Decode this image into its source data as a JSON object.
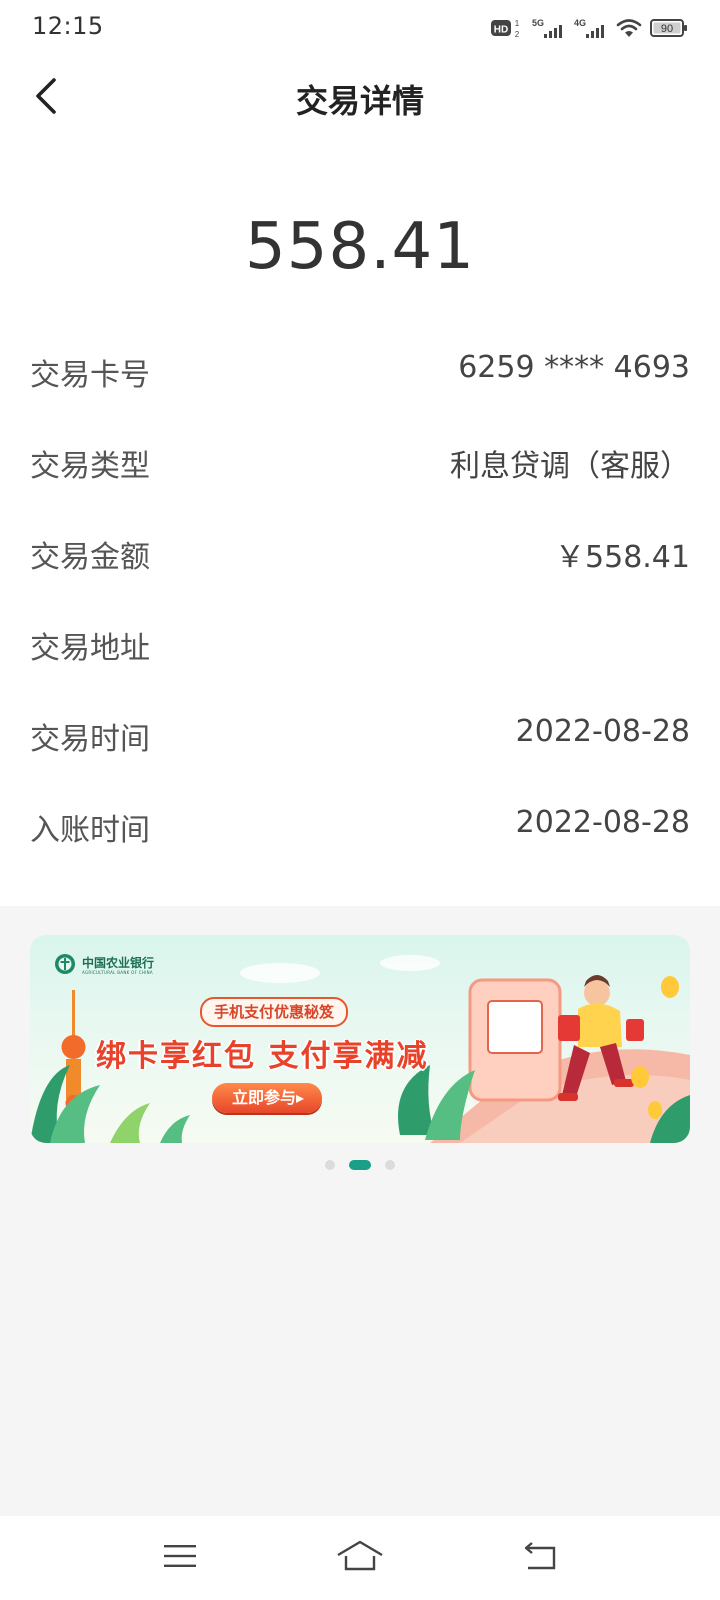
{
  "status_bar": {
    "time": "12:15",
    "battery": "90",
    "network_1": "5G",
    "network_2": "4G",
    "hd_label": "HD"
  },
  "header": {
    "title": "交易详情"
  },
  "amount": "558.41",
  "details": [
    {
      "label": "交易卡号",
      "value": "6259 **** 4693"
    },
    {
      "label": "交易类型",
      "value": "利息贷调（客服）"
    },
    {
      "label": "交易金额",
      "value": "￥558.41"
    },
    {
      "label": "交易地址",
      "value": ""
    },
    {
      "label": "交易时间",
      "value": "2022-08-28"
    },
    {
      "label": "入账时间",
      "value": "2022-08-28"
    }
  ],
  "banner": {
    "bank_name": "中国农业银行",
    "bank_name_en": "AGRICULTURAL BANK OF CHINA",
    "tag": "手机支付优惠秘笈",
    "headline": "绑卡享红包 支付享满减",
    "button": "立即参与",
    "current_slide": 2,
    "total_slides": 3
  },
  "colors": {
    "accent": "#1aa087",
    "promo_red": "#e8432a",
    "background_gray": "#f5f5f5"
  },
  "icons": {
    "back": "chevron-left-icon",
    "menu": "menu-icon",
    "home": "home-icon",
    "return": "return-icon"
  }
}
